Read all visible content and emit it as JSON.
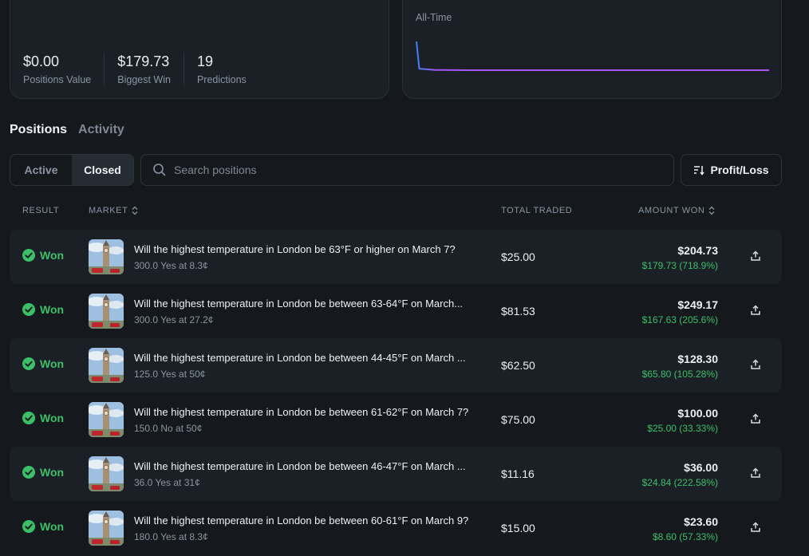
{
  "stats": [
    {
      "value": "$0.00",
      "label": "Positions Value"
    },
    {
      "value": "$179.73",
      "label": "Biggest Win"
    },
    {
      "value": "19",
      "label": "Predictions"
    }
  ],
  "pnl": {
    "range_label": "All-Time",
    "chart_data": {
      "type": "line",
      "series": [
        {
          "values": [
            100,
            10,
            6,
            5,
            5,
            5,
            5,
            5,
            5,
            5,
            5,
            5,
            5
          ]
        }
      ],
      "colors": [
        "#3b82f6",
        "#a855f7"
      ]
    }
  },
  "tabs": [
    "Positions",
    "Activity"
  ],
  "toggle": [
    "Active",
    "Closed"
  ],
  "search": {
    "placeholder": "Search positions"
  },
  "sort": {
    "label": "Profit/Loss"
  },
  "columns": {
    "result": "RESULT",
    "market": "MARKET",
    "total_traded": "TOTAL TRADED",
    "amount_won": "AMOUNT WON"
  },
  "rows": [
    {
      "result": "Won",
      "title": "Will the highest temperature in London be 63°F or higher on March 7?",
      "sub": "300.0 Yes at 8.3¢",
      "traded": "$25.00",
      "amount": "$204.73",
      "pnl": "$179.73 (718.9%)"
    },
    {
      "result": "Won",
      "title": "Will the highest temperature in London be between 63-64°F on March...",
      "sub": "300.0 Yes at 27.2¢",
      "traded": "$81.53",
      "amount": "$249.17",
      "pnl": "$167.63 (205.6%)"
    },
    {
      "result": "Won",
      "title": "Will the highest temperature in London be between 44-45°F on March ...",
      "sub": "125.0 Yes at 50¢",
      "traded": "$62.50",
      "amount": "$128.30",
      "pnl": "$65.80 (105.28%)"
    },
    {
      "result": "Won",
      "title": "Will the highest temperature in London be between 61-62°F on March 7?",
      "sub": "150.0 No at 50¢",
      "traded": "$75.00",
      "amount": "$100.00",
      "pnl": "$25.00 (33.33%)"
    },
    {
      "result": "Won",
      "title": "Will the highest temperature in London be between 46-47°F on March ...",
      "sub": "36.0 Yes at 31¢",
      "traded": "$11.16",
      "amount": "$36.00",
      "pnl": "$24.84 (222.58%)"
    },
    {
      "result": "Won",
      "title": "Will the highest temperature in London be between 60-61°F on March 9?",
      "sub": "180.0 Yes at 8.3¢",
      "traded": "$15.00",
      "amount": "$23.60",
      "pnl": "$8.60 (57.33%)"
    }
  ]
}
